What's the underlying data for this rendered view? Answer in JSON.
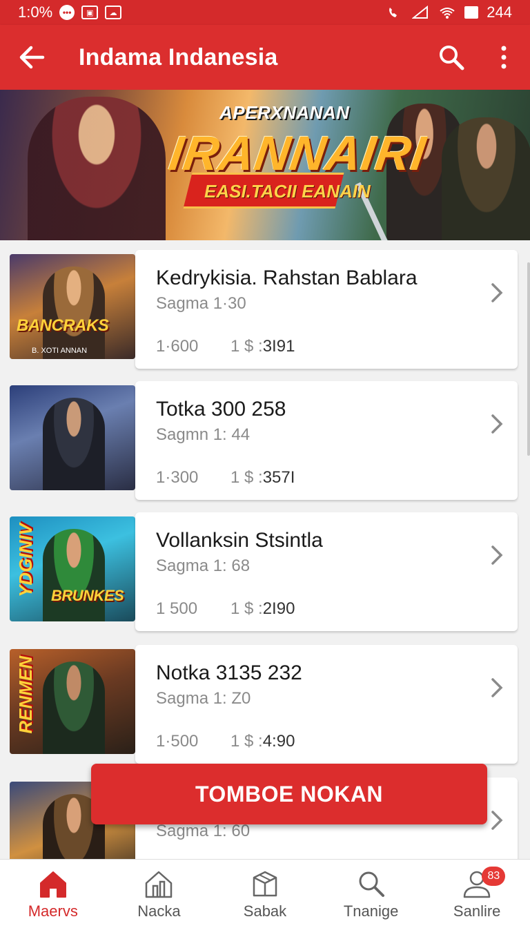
{
  "status_bar": {
    "time": "1:0%",
    "right_text": "244"
  },
  "app_bar": {
    "title": "Indama Indanesia"
  },
  "banner": {
    "subtitle": "APERXNANAN",
    "title": "IRANNAIRI",
    "ribbon": "EASI.TACII EANAIN"
  },
  "games": [
    {
      "title": "Kedrykisia. Rahstan Bablara",
      "sub": "Sagma 1·30",
      "meta1": "1·600",
      "meta2_prefix": "1 $ :",
      "meta2_value": "3I91",
      "thumb_label": "BANCRAKS",
      "thumb_sublabel": "B. XOTI ANNAN"
    },
    {
      "title": "Totka 300 258",
      "sub": "Sagmn 1: 44",
      "meta1": "1·300",
      "meta2_prefix": "1 $ :",
      "meta2_value": "357I",
      "thumb_label": "",
      "thumb_sublabel": ""
    },
    {
      "title": "Vollanksin Stsintla",
      "sub": "Sagma 1: 68",
      "meta1": "1 500",
      "meta2_prefix": "1 $ :",
      "meta2_value": "2I90",
      "thumb_label": "BRUNKES",
      "thumb_sublabel": "",
      "thumb_vlabel": "YDGINIV"
    },
    {
      "title": "Notka 3135 232",
      "sub": "Sagma 1: Z0",
      "meta1": "1·500",
      "meta2_prefix": "1 $ :",
      "meta2_value": "4:90",
      "thumb_label": "",
      "thumb_sublabel": "",
      "thumb_vlabel": "RENMEN"
    },
    {
      "title": "",
      "sub": "Sagma 1: 60",
      "meta1": "",
      "meta2_prefix": "",
      "meta2_value": "",
      "thumb_label": "",
      "thumb_sublabel": ""
    }
  ],
  "fab": {
    "label": "TOMBOE NOKAN"
  },
  "bottom_nav": [
    {
      "label": "Maervs",
      "icon": "home-icon",
      "active": true
    },
    {
      "label": "Nacka",
      "icon": "building-icon"
    },
    {
      "label": "Sabak",
      "icon": "box-icon"
    },
    {
      "label": "Tnanige",
      "icon": "search-icon"
    },
    {
      "label": "Sanlire",
      "icon": "profile-icon",
      "badge": "83"
    }
  ],
  "colors": {
    "primary": "#db2e2e",
    "status_bar": "#d42a2b"
  }
}
